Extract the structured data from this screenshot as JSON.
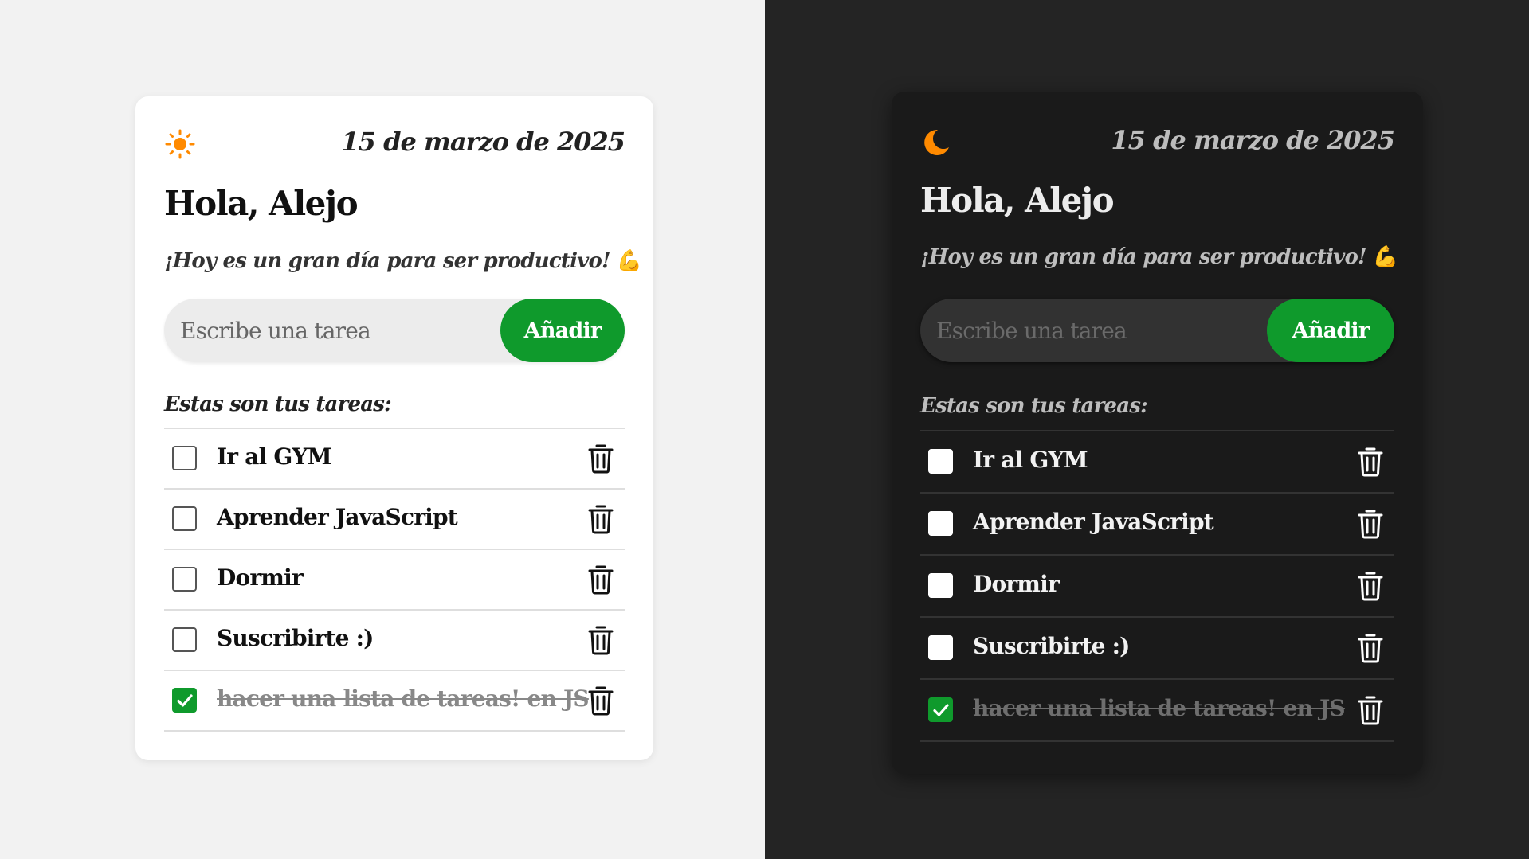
{
  "colors": {
    "accent_green": "#0f9a2c",
    "sun_orange": "#ff8a00",
    "light_bg": "#f2f2f2",
    "dark_bg": "#242424",
    "dark_card": "#1a1a1a"
  },
  "light_panel": {
    "theme_icon": "sun-icon",
    "date": "15 de marzo de 2025",
    "greeting": "Hola, Alejo",
    "motivation": "¡Hoy es un gran día para ser productivo!",
    "motivation_emoji": "💪",
    "input_placeholder": "Escribe una tarea",
    "add_label": "Añadir",
    "list_title": "Estas son tus tareas:",
    "tasks": [
      {
        "label": "Ir al GYM",
        "done": false
      },
      {
        "label": "Aprender JavaScript",
        "done": false
      },
      {
        "label": "Dormir",
        "done": false
      },
      {
        "label": "Suscribirte :)",
        "done": false
      },
      {
        "label": "hacer una lista de tareas! en JS",
        "done": true
      }
    ]
  },
  "dark_panel": {
    "theme_icon": "moon-icon",
    "date": "15 de marzo de 2025",
    "greeting": "Hola, Alejo",
    "motivation": "¡Hoy es un gran día para ser productivo!",
    "motivation_emoji": "💪",
    "input_placeholder": "Escribe una tarea",
    "add_label": "Añadir",
    "list_title": "Estas son tus tareas:",
    "tasks": [
      {
        "label": "Ir al GYM",
        "done": false
      },
      {
        "label": "Aprender JavaScript",
        "done": false
      },
      {
        "label": "Dormir",
        "done": false
      },
      {
        "label": "Suscribirte :)",
        "done": false
      },
      {
        "label": "hacer una lista de tareas! en JS",
        "done": true
      }
    ]
  }
}
